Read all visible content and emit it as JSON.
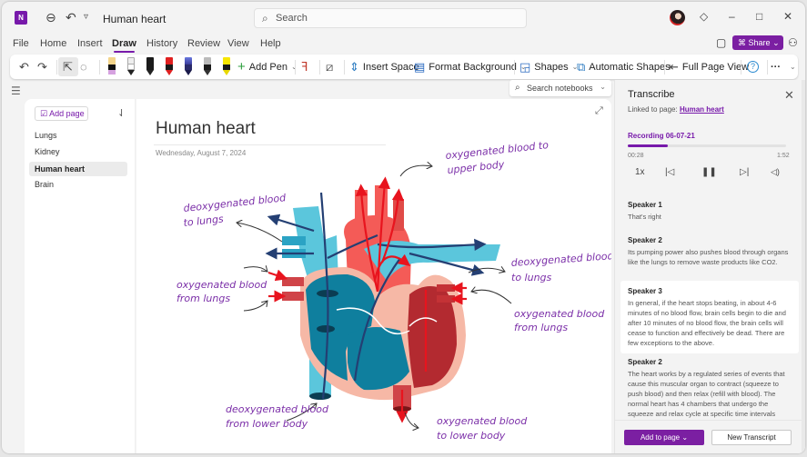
{
  "titlebar": {
    "app_icon": "N",
    "back_icon": "⊖",
    "undo_icon": "↶",
    "dropdown_icon": "▿",
    "doc_title": "Human heart",
    "search_placeholder": "Search",
    "search_icon": "⌕",
    "diamond_icon": "◇",
    "minimize": "–",
    "maximize": "□",
    "close": "✕"
  },
  "menu": {
    "tabs": [
      "File",
      "Home",
      "Insert",
      "Draw",
      "History",
      "Review",
      "View",
      "Help"
    ],
    "active": "Draw",
    "share_label": "Share",
    "share_icon": "⌘",
    "share_chevron": "⌄"
  },
  "ribbon": {
    "undo": "↶",
    "redo": "↷",
    "select_icon": "⇱",
    "lasso_icon": "◌",
    "pens": [
      {
        "name": "pen-eraser",
        "cap": "#f3d48a",
        "body": "#111111",
        "tip": "#d6a2e0"
      },
      {
        "name": "pen-white",
        "cap": "#eeeeee",
        "body": "#ffffff",
        "tip": "#222222"
      },
      {
        "name": "pen-black",
        "cap": "#1a1a1a",
        "body": "#1a1a1a",
        "tip": "#111111"
      },
      {
        "name": "pen-red",
        "cap": "#e02020",
        "body": "#1a1a1a",
        "tip": "#e02020"
      },
      {
        "name": "pen-galaxy",
        "cap": "#5a6ad0",
        "body": "#2a2a6a",
        "tip": "#1a1a4a"
      },
      {
        "name": "pen-silver",
        "cap": "#bbbbbb",
        "body": "#1a1a1a",
        "tip": "#333333"
      },
      {
        "name": "highlighter-yellow",
        "cap": "#f7e600",
        "body": "#f7e600",
        "tip": "#d8c800"
      }
    ],
    "add_pen": "Add Pen",
    "ink_to_text_icon": "ꟗ",
    "ruler_icon": "⧄",
    "insert_space": "Insert Space",
    "format_background": "Format Background",
    "shapes": "Shapes",
    "automatic_shapes": "Automatic Shapes",
    "full_page_view": "Full Page View",
    "help_icon": "?",
    "more_icon": "···",
    "collapse_icon": "⌄"
  },
  "notebook_search": {
    "placeholder": "Search notebooks"
  },
  "pages": {
    "add_page": "Add page",
    "items": [
      "Lungs",
      "Kidney",
      "Human heart",
      "Brain"
    ],
    "selected": "Human heart"
  },
  "page": {
    "title": "Human heart",
    "date": "Wednesday, August 7, 2024",
    "annotations": [
      {
        "id": "upper-body-out",
        "lines": [
          "oxygenated blood to",
          "upper body"
        ]
      },
      {
        "id": "deoxy-to-lungs-left",
        "lines": [
          "deoxygenated blood",
          "to lungs"
        ]
      },
      {
        "id": "oxy-from-lungs-left",
        "lines": [
          "oxygenated blood",
          "from lungs"
        ]
      },
      {
        "id": "deoxy-to-lungs-right",
        "lines": [
          "deoxygenated blood",
          "to lungs"
        ]
      },
      {
        "id": "oxy-from-lungs-right",
        "lines": [
          "oxygenated blood",
          "from lungs"
        ]
      },
      {
        "id": "deoxy-from-lower",
        "lines": [
          "deoxygenated blood",
          "from lower body"
        ]
      },
      {
        "id": "oxy-to-lower",
        "lines": [
          "oxygenated blood",
          "to lower body"
        ]
      }
    ],
    "colors": {
      "deoxy_light": "#5bc6dc",
      "deoxy_dark": "#0f7f9e",
      "oxy_light": "#f45b57",
      "oxy_dark": "#b32a30",
      "pericardium": "#f6b8a6",
      "vessel_line": "#243f73",
      "ink": "#7b2fa8"
    }
  },
  "transcribe": {
    "title": "Transcribe",
    "linked_prefix": "Linked to page: ",
    "linked_page": "Human heart",
    "recording_name": "Recording 06-07-21",
    "elapsed": "00:28",
    "duration": "1:52",
    "progress_fraction": 0.25,
    "speed": "1x",
    "controls": {
      "prev": "|◁",
      "pause": "⏸",
      "next": "▷|",
      "volume": "🔈"
    },
    "segments": [
      {
        "speaker": "Speaker 1",
        "text": "That's right",
        "highlight": false
      },
      {
        "speaker": "Speaker 2",
        "text": "Its pumping power also pushes blood through organs like the lungs to remove waste products like CO2.",
        "highlight": false
      },
      {
        "speaker": "Speaker 3",
        "text": "In general, if the heart stops beating, in about 4-6 minutes of no blood flow, brain cells begin to die and after 10 minutes of no blood flow, the brain cells will cease to function and effectively be dead. There are few exceptions to the above.",
        "highlight": true
      },
      {
        "speaker": "Speaker 2",
        "text": "The heart works by a regulated series of events that cause this muscular organ to contract (squeeze to push blood) and then relax (refill with blood). The normal heart has 4 chambers that undergo the squeeze and relax cycle at specific time intervals",
        "highlight": false
      }
    ],
    "add_to_page": "Add to page",
    "add_chevron": "⌄",
    "new_transcript": "New Transcript",
    "accent": "#7719aa"
  }
}
